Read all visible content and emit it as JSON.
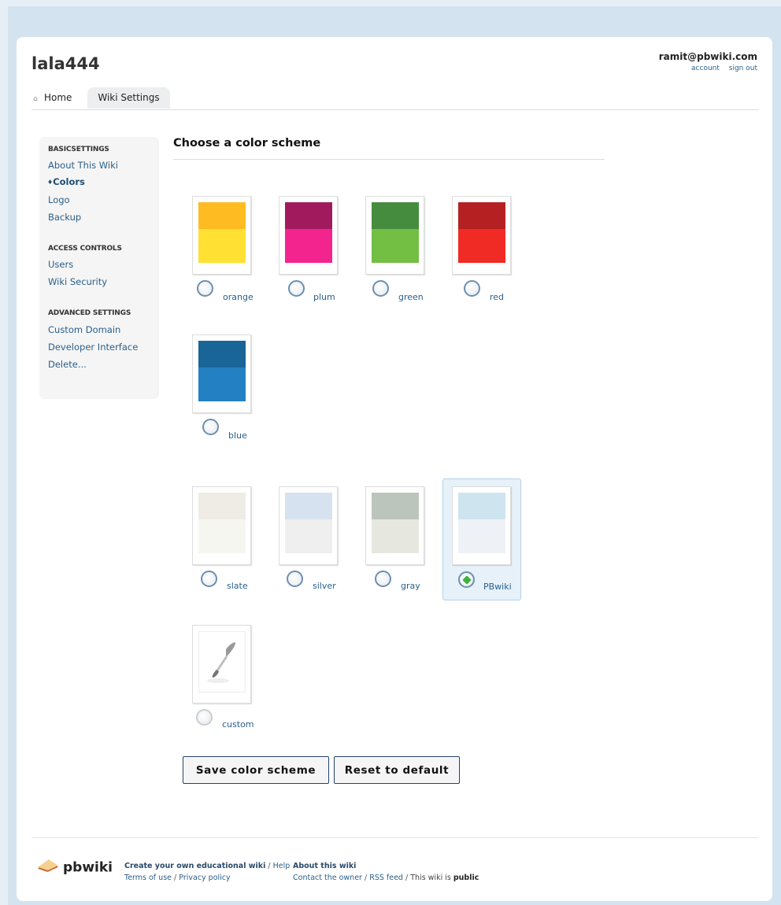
{
  "wiki": {
    "title": "lala444"
  },
  "user": {
    "email": "ramit@pbwiki.com",
    "account_label": "account",
    "signout_label": "sign out"
  },
  "tabs": {
    "home": "Home",
    "settings": "Wiki Settings"
  },
  "sidebar": {
    "basic_heading": "BASICSETTINGS",
    "basic": [
      "About This Wiki",
      "Colors",
      "Logo",
      "Backup"
    ],
    "active_marker": "♦",
    "access_heading": "ACCESS CONTROLS",
    "access": [
      "Users",
      "Wiki Security"
    ],
    "advanced_heading": "ADVANCED SETTINGS",
    "advanced": [
      "Custom Domain",
      "Developer Interface",
      "Delete..."
    ]
  },
  "main": {
    "title": "Choose a color scheme"
  },
  "schemes": [
    {
      "label": "orange",
      "top": "#ffbb22",
      "bottom": "#ffe033",
      "selected": false
    },
    {
      "label": "plum",
      "top": "#a21a5e",
      "bottom": "#f4248f",
      "selected": false
    },
    {
      "label": "green",
      "top": "#468c3e",
      "bottom": "#72bf44",
      "selected": false
    },
    {
      "label": "red",
      "top": "#b52122",
      "bottom": "#f02a24",
      "selected": false
    },
    {
      "label": "blue",
      "top": "#1a6598",
      "bottom": "#2280c3",
      "selected": false
    },
    {
      "label": "slate",
      "top": "#eeece4",
      "bottom": "#f6f6f0",
      "selected": false
    },
    {
      "label": "silver",
      "top": "#d6e2ef",
      "bottom": "#efefef",
      "selected": false
    },
    {
      "label": "gray",
      "top": "#bcc5bc",
      "bottom": "#e6e8e0",
      "selected": false
    },
    {
      "label": "PBwiki",
      "top": "#cee5f0",
      "bottom": "#eef2f6",
      "selected": true
    },
    {
      "label": "custom",
      "top": "",
      "bottom": "",
      "selected": false
    }
  ],
  "buttons": {
    "save": "Save color scheme",
    "reset": "Reset to default"
  },
  "footer": {
    "logo_text": "pbwiki",
    "create_link": "Create your own educational wiki",
    "help": "Help",
    "terms": "Terms of use",
    "privacy": "Privacy policy",
    "about_heading": "About this wiki",
    "contact": "Contact the owner",
    "rss": "RSS feed",
    "public_prefix": "This wiki is",
    "public_value": "public"
  }
}
